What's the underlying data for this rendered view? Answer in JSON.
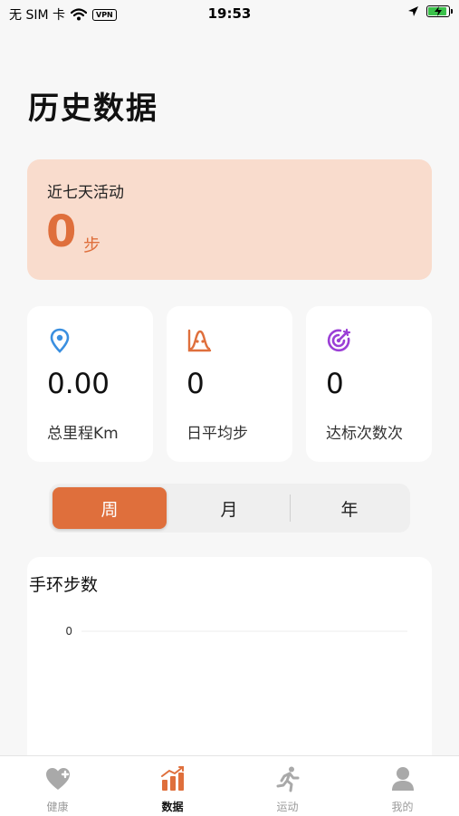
{
  "status_bar": {
    "carrier": "无 SIM 卡",
    "vpn": "VPN",
    "time": "19:53"
  },
  "page_title": "历史数据",
  "summary": {
    "label": "近七天活动",
    "value": "0",
    "unit": "步"
  },
  "stats": [
    {
      "value": "0.00",
      "label": "总里程Km",
      "icon": "location-pin-icon",
      "color": "#3a8fe0"
    },
    {
      "value": "0",
      "label": "日平均步",
      "icon": "bell-curve-chart-icon",
      "color": "#df6f3c"
    },
    {
      "value": "0",
      "label": "达标次数次",
      "icon": "target-icon",
      "color": "#9b3fd6"
    }
  ],
  "period_tabs": {
    "items": [
      "周",
      "月",
      "年"
    ],
    "selected": "周"
  },
  "chart": {
    "title": "手环步数"
  },
  "chart_data": {
    "type": "bar",
    "title": "手环步数",
    "categories": [],
    "values": [],
    "yticks": [
      "0"
    ],
    "ylim": [
      0,
      0
    ],
    "grid": true
  },
  "tab_bar": [
    {
      "label": "健康",
      "icon": "heart-plus-icon",
      "active": false
    },
    {
      "label": "数据",
      "icon": "bar-chart-trend-icon",
      "active": true
    },
    {
      "label": "运动",
      "icon": "running-icon",
      "active": false
    },
    {
      "label": "我的",
      "icon": "person-icon",
      "active": false
    }
  ],
  "colors": {
    "accent": "#df6f3c",
    "summary_bg": "#f9dccd",
    "battery": "#3ac14a"
  }
}
